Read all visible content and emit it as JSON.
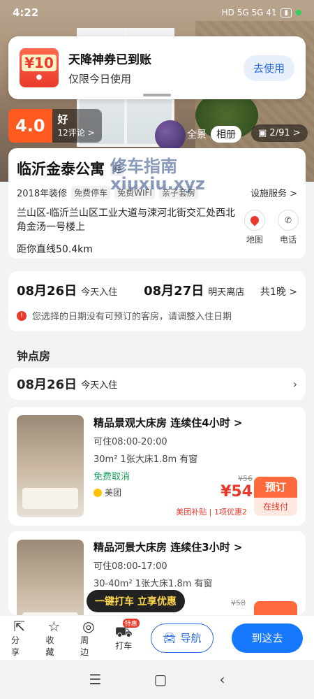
{
  "status": {
    "time": "4:22",
    "right": "HD 5G 5G 41"
  },
  "notification": {
    "coupon_amount": "¥10",
    "title": "天降神券已到账",
    "subtitle": "仅限今日使用",
    "button": "去使用"
  },
  "header": {
    "score": "4.0",
    "score_word": "好",
    "reviews": "12评论 >",
    "panorama": "全景",
    "album_tab": "相册",
    "album_count": "2/91 >"
  },
  "hotel": {
    "name": "临沂金泰公寓",
    "type_tag": "经",
    "year": "2018年装修",
    "tags": [
      "免费停车",
      "免费WIFI",
      "亲子套房"
    ],
    "facilities": "设施服务 >",
    "address": "兰山区-临沂兰山区工业大道与涑河北街交汇处西北角金汤一号楼上",
    "distance": "距你直线50.4km",
    "map_label": "地图",
    "phone_label": "电话",
    "watermark_line1": "修车指南",
    "watermark_line2": "xiuxiu.xyz"
  },
  "dates": {
    "checkin": "08月26日",
    "checkin_sub": "今天入住",
    "checkout": "08月27日",
    "checkout_sub": "明天离店",
    "nights": "共1晚 >",
    "warning": "您选择的日期没有可预订的客房，请调整入住日期"
  },
  "hourly": {
    "section_title": "钟点房",
    "date": "08月26日",
    "date_sub": "今天入住"
  },
  "rooms": [
    {
      "name": "精品景观大床房 连续住4小时 >",
      "time": "可住08:00-20:00",
      "spec": "30m² 1张大床1.8m 有窗",
      "cancel": "免费取消",
      "source": "美团",
      "old_price": "¥56",
      "price": "¥54",
      "book": "预订",
      "book_sub": "在线付",
      "subsidy": "美团补贴 | 1项优惠2"
    },
    {
      "name": "精品河景大床房 连续住3小时 >",
      "time": "可住08:00-17:00",
      "spec": "30-40m² 1张大床1.8m 有窗",
      "old_price": "¥58"
    }
  ],
  "taxi_tip": "一键打车 立享优惠",
  "bottom": {
    "share": "分享",
    "fav": "收藏",
    "nearby": "周边",
    "taxi": "打车",
    "taxi_badge": "特惠",
    "navigate": "导航",
    "go": "到这去"
  }
}
